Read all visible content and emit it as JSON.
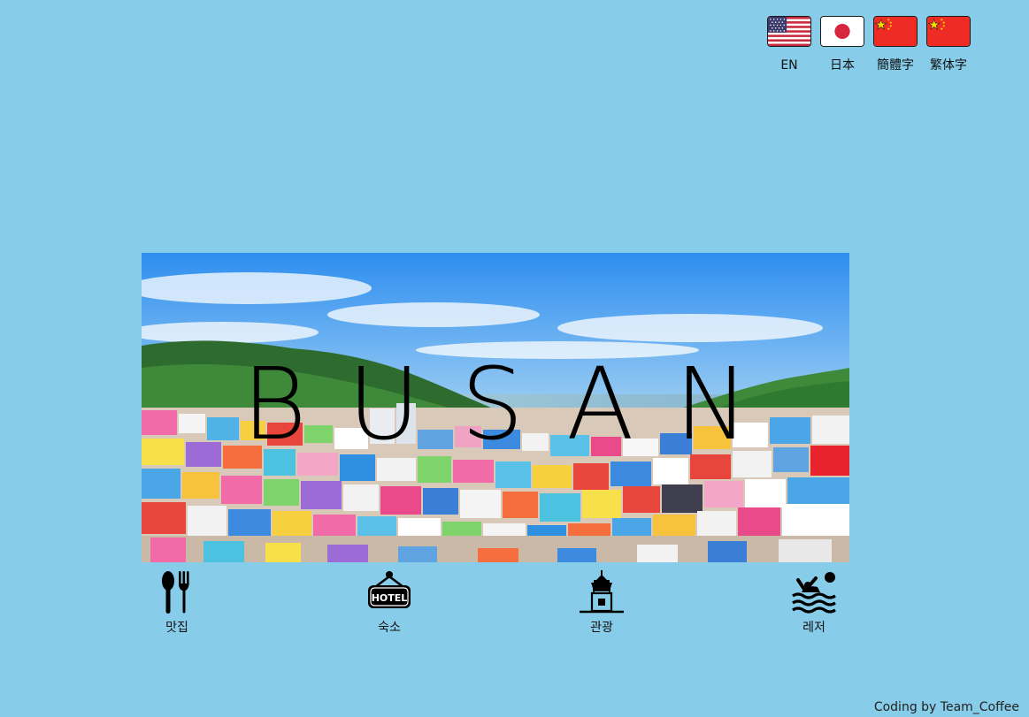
{
  "languages": [
    {
      "label": "EN",
      "flag": "us-flag-icon"
    },
    {
      "label": "日本",
      "flag": "japan-flag-icon"
    },
    {
      "label": "簡體字",
      "flag": "china-flag-icon"
    },
    {
      "label": "繁体字",
      "flag": "china-flag-icon"
    }
  ],
  "hero": {
    "title": "BUSAN"
  },
  "categories": [
    {
      "label": "맛집",
      "icon": "fork-spoon-icon"
    },
    {
      "label": "숙소",
      "icon": "hotel-sign-icon"
    },
    {
      "label": "관광",
      "icon": "tower-icon"
    },
    {
      "label": "레저",
      "icon": "swimmer-icon"
    }
  ],
  "hotel_sign_text": "HOTEL",
  "footer": {
    "credit": "Coding by Team_Coffee"
  },
  "colors": {
    "background": "#87CCE8",
    "text": "#111111"
  }
}
